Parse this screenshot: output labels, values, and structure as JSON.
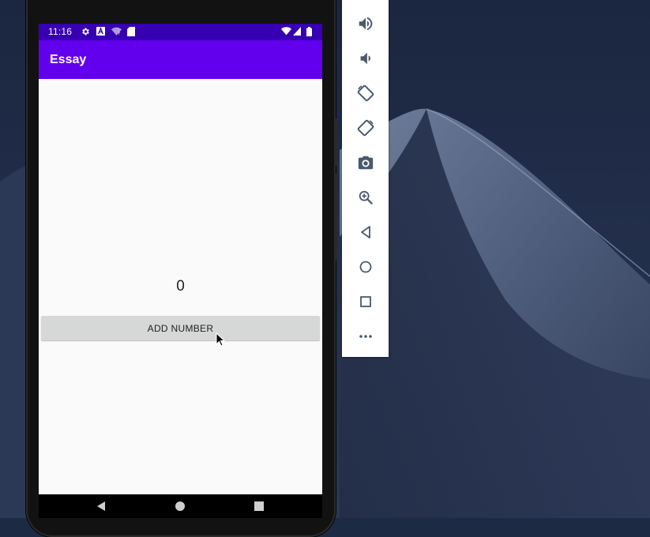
{
  "status_bar": {
    "time": "11:16",
    "icons_left": [
      "settings-icon",
      "a-badge-icon",
      "wifi-question-icon",
      "sd-card-icon"
    ],
    "icons_right": [
      "wifi-icon",
      "signal-icon",
      "battery-icon"
    ]
  },
  "app_bar": {
    "title": "Essay"
  },
  "main": {
    "counter": "0",
    "add_button_label": "ADD NUMBER"
  },
  "nav_bar": {
    "buttons": [
      "back-icon",
      "home-icon",
      "recents-icon"
    ]
  },
  "emulator_toolbar": {
    "buttons": [
      "volume-up-icon",
      "volume-down-icon",
      "rotate-left-icon",
      "rotate-right-icon",
      "camera-icon",
      "zoom-icon",
      "back-icon",
      "home-icon",
      "overview-icon",
      "more-icon"
    ]
  },
  "colors": {
    "status_bar": "#3700b3",
    "app_bar": "#6200ee",
    "screen_bg": "#fafafa",
    "button_bg": "#d6d7d7",
    "toolbar_icon": "#4a5a6a"
  }
}
